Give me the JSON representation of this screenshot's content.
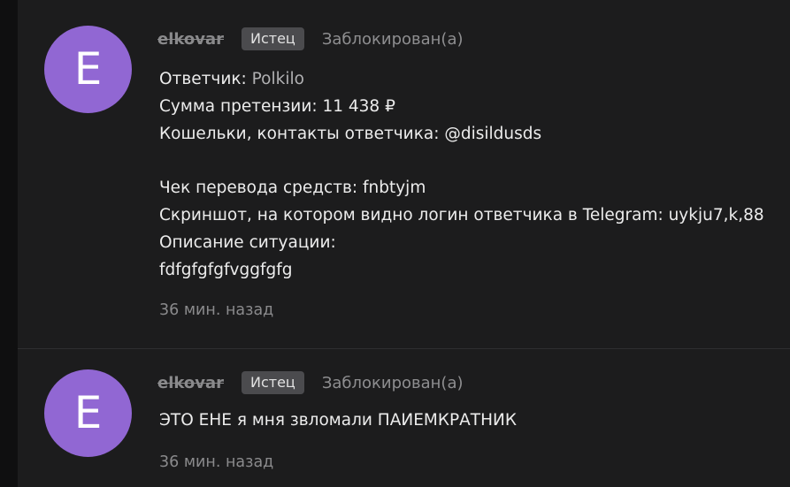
{
  "posts": [
    {
      "avatar_letter": "E",
      "username": "elkovar",
      "role_badge": "Истец",
      "status": "Заблокирован(а)",
      "respondent_label": "Ответчик:",
      "respondent_value": "Polkilo",
      "claim_line": "Сумма претензии: 11 438 ₽",
      "contacts_line": "Кошельки, контакты ответчика: @disildusds",
      "receipt_line": "Чек перевода средств: fnbtyjm",
      "screenshot_line": "Скриншот, на котором видно логин ответчика в Telegram: uykju7,k,88",
      "description_label": "Описание ситуации:",
      "description_text": "fdfgfgfgfvggfgfg",
      "time": "36 мин. назад"
    },
    {
      "avatar_letter": "E",
      "username": "elkovar",
      "role_badge": "Истец",
      "status": "Заблокирован(а)",
      "message": "ЭТО ЕНЕ я мня звломали ПАИЕМКРАТНИК",
      "time": "36 мин. назад"
    }
  ]
}
